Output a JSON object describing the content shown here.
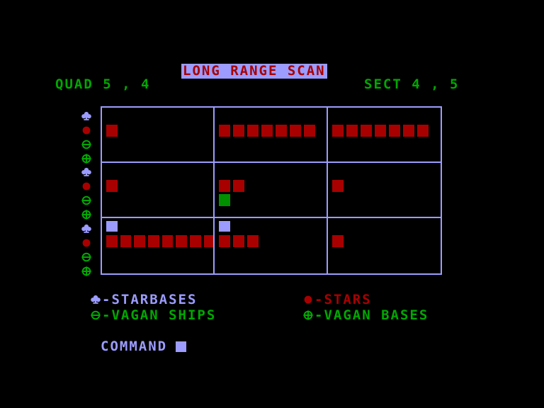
{
  "header": {
    "title": "LONG RANGE SCAN",
    "title_bg": "#9c9cff",
    "title_fg": "#a80000",
    "quad_label": "QUAD 5 , 4",
    "sect_label": "SECT 4 , 5"
  },
  "colors": {
    "background": "#000000",
    "grid_line": "#9c9cff",
    "star_red": "#a80000",
    "ship_green": "#009000",
    "text_green": "#00a800",
    "starbase_blue": "#9c9cff"
  },
  "row_icons": [
    {
      "name": "starbase-icon",
      "color": "#9c9cff"
    },
    {
      "name": "star-icon",
      "color": "#a80000"
    },
    {
      "name": "vagan-ship-icon",
      "color": "#00a800"
    },
    {
      "name": "vagan-base-icon",
      "color": "#00a800"
    }
  ],
  "scan_grid": {
    "rows": 3,
    "cols": 3,
    "categories": [
      "starbases",
      "stars",
      "vagan_ships",
      "vagan_bases"
    ],
    "cells": [
      [
        {
          "starbases": 0,
          "stars": 1,
          "vagan_ships": 0,
          "vagan_bases": 0
        },
        {
          "starbases": 0,
          "stars": 7,
          "vagan_ships": 0,
          "vagan_bases": 0
        },
        {
          "starbases": 0,
          "stars": 7,
          "vagan_ships": 0,
          "vagan_bases": 0
        }
      ],
      [
        {
          "starbases": 0,
          "stars": 1,
          "vagan_ships": 0,
          "vagan_bases": 0
        },
        {
          "starbases": 0,
          "stars": 2,
          "vagan_ships": 1,
          "vagan_bases": 0
        },
        {
          "starbases": 0,
          "stars": 1,
          "vagan_ships": 0,
          "vagan_bases": 0
        }
      ],
      [
        {
          "starbases": 1,
          "stars": 8,
          "vagan_ships": 0,
          "vagan_bases": 0
        },
        {
          "starbases": 1,
          "stars": 3,
          "vagan_ships": 0,
          "vagan_bases": 0
        },
        {
          "starbases": 0,
          "stars": 1,
          "vagan_ships": 0,
          "vagan_bases": 0
        }
      ]
    ]
  },
  "legend": {
    "starbases": {
      "label": "-STARBASES",
      "icon": "starbase-icon",
      "color": "#9c9cff"
    },
    "stars": {
      "label": "-STARS",
      "icon": "star-icon",
      "color": "#a80000"
    },
    "vagan_ships": {
      "label": "-VAGAN SHIPS",
      "icon": "vagan-ship-icon",
      "color": "#00a800"
    },
    "vagan_bases": {
      "label": "-VAGAN BASES",
      "icon": "vagan-base-icon",
      "color": "#00a800"
    }
  },
  "command": {
    "prompt": "COMMAND",
    "input_value": "",
    "cursor_color": "#9c9cff"
  }
}
